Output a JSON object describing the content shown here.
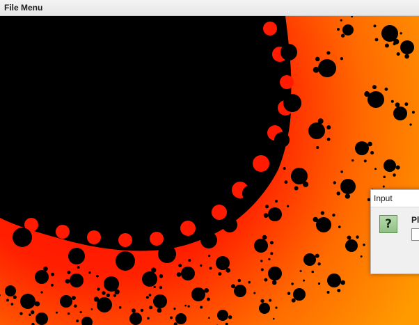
{
  "menubar": {
    "file_menu_label": "File Menu"
  },
  "fractal": {
    "type": "mandelbrot-zoom",
    "set_color": "#000000",
    "gradient_colors": [
      "#ff0000",
      "#ff6a00",
      "#ff9900"
    ]
  },
  "dialog": {
    "title": "Input",
    "icon": "question-icon",
    "icon_glyph": "?",
    "prompt_partial": "Pl",
    "input_value": ""
  }
}
